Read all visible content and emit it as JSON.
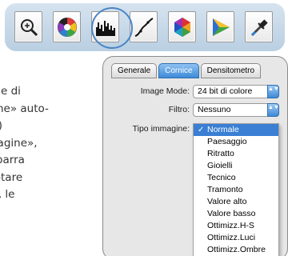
{
  "toolbar": {
    "buttons": [
      {
        "name": "zoom-tool-button",
        "icon": "magnifier-icon"
      },
      {
        "name": "color-balance-button",
        "icon": "color-wheel-icon"
      },
      {
        "name": "histogram-button",
        "icon": "histogram-icon"
      },
      {
        "name": "curves-button",
        "icon": "curve-icon"
      },
      {
        "name": "hue-saturation-button",
        "icon": "color-hexagon-icon"
      },
      {
        "name": "selective-color-button",
        "icon": "color-triangle-icon"
      },
      {
        "name": "eyedropper-button",
        "icon": "eyedropper-icon"
      }
    ],
    "highlighted": "histogram-button"
  },
  "description": {
    "lines": [
      "sezione di",
      "ttazione» auto-",
      "izzata)",
      "«Immagine»,",
      "nella barra",
      "ete notare",
      "le luci, le"
    ]
  },
  "dialog": {
    "tabs": [
      "Generale",
      "Cornice",
      "Densitometro"
    ],
    "active_tab": "Cornice",
    "image_mode_label": "Image Mode:",
    "image_mode_value": "24 bit di colore",
    "filter_label": "Filtro:",
    "filter_value": "Nessuno",
    "image_type_label": "Tipo immagine:",
    "image_type_options": [
      "Normale",
      "Paesaggio",
      "Ritratto",
      "Gioielli",
      "Tecnico",
      "Tramonto",
      "Valore alto",
      "Valore basso",
      "Ottimizz.H-S",
      "Ottimizz.Luci",
      "Ottimizz.Ombre"
    ],
    "selected_option": "Normale",
    "check_mark": "✓",
    "arrows_glyph": "▲▼"
  },
  "colors": {
    "toolbar_bg": "#c7d9ea",
    "highlight_ring": "#4b86c5",
    "tab_active": "#3d8ad8",
    "selection": "#3a7fd4"
  }
}
